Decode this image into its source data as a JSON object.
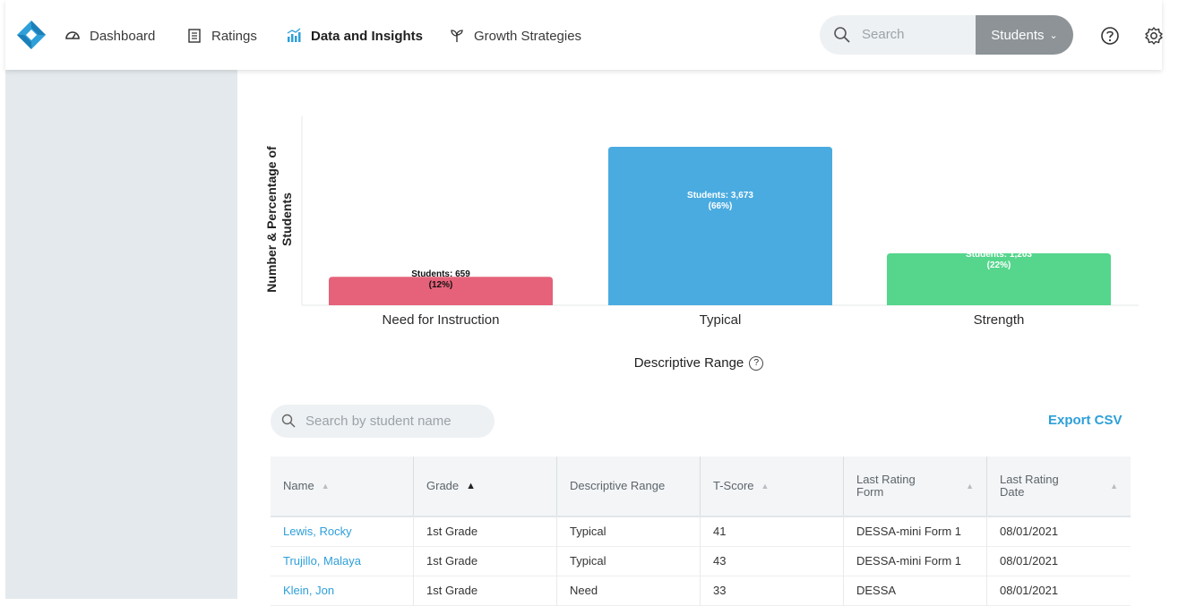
{
  "nav": {
    "items": [
      {
        "label": "Dashboard",
        "icon": "gauge-icon"
      },
      {
        "label": "Ratings",
        "icon": "clipboard-icon"
      },
      {
        "label": "Data and Insights",
        "icon": "bar-chart-icon",
        "active": true
      },
      {
        "label": "Growth Strategies",
        "icon": "sprout-icon"
      }
    ],
    "search_placeholder": "Search",
    "search_scope": "Students",
    "help_icon": "help-icon",
    "settings_icon": "gear-icon"
  },
  "chart_data": {
    "type": "bar",
    "categories": [
      "Need for Instruction",
      "Typical",
      "Strength"
    ],
    "values": [
      659,
      3673,
      1203
    ],
    "percentages": [
      "12%",
      "66%",
      "22%"
    ],
    "data_labels": [
      "Students: 659",
      "Students: 3,673",
      "Students: 1,203"
    ],
    "colors": [
      "#e5627a",
      "#4aabe0",
      "#55d68c"
    ],
    "ylabel": "Number & Percentage of Students",
    "xlabel": "Descriptive Range",
    "grid": false,
    "ylim": [
      0,
      4400
    ]
  },
  "table_search": {
    "placeholder": "Search by student name"
  },
  "export_label": "Export CSV",
  "table": {
    "columns": [
      {
        "label": "Name"
      },
      {
        "label": "Grade"
      },
      {
        "label": "Descriptive Range"
      },
      {
        "label": "T-Score"
      },
      {
        "label": "Last Rating Form"
      },
      {
        "label": "Last Rating Date"
      }
    ],
    "rows": [
      [
        "Lewis, Rocky",
        "1st Grade",
        "Typical",
        "41",
        "DESSA-mini Form 1",
        "08/01/2021"
      ],
      [
        "Trujillo, Malaya",
        "1st Grade",
        "Typical",
        "43",
        "DESSA-mini Form 1",
        "08/01/2021"
      ],
      [
        "Klein, Jon",
        "1st Grade",
        "Need",
        "33",
        "DESSA",
        "08/01/2021"
      ]
    ]
  }
}
